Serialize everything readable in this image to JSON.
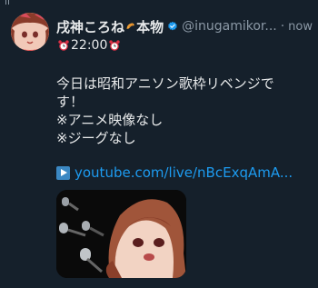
{
  "tweet": {
    "display_name": "戌神ころね",
    "display_name_suffix": "本物",
    "handle": "@inugamikor...",
    "separator": "·",
    "timestamp": "now",
    "time_line": "22:00",
    "body_lines": [
      "今日は昭和アニソン歌枠リベンジで",
      "す！",
      "※アニメ映像なし",
      "※ジーグなし"
    ],
    "link_text": "youtube.com/live/nBcExqAmA..."
  },
  "icons": {
    "avatar": "avatar-image",
    "croissant": "croissant-emoji-icon",
    "verified": "verified-badge-icon",
    "alarm": "alarm-clock-emoji-icon",
    "play": "play-button-emoji-icon"
  },
  "colors": {
    "background": "#15202b",
    "text": "#e7e9ea",
    "muted": "#8b98a5",
    "link": "#1d9bf0",
    "verified": "#1d9bf0"
  }
}
